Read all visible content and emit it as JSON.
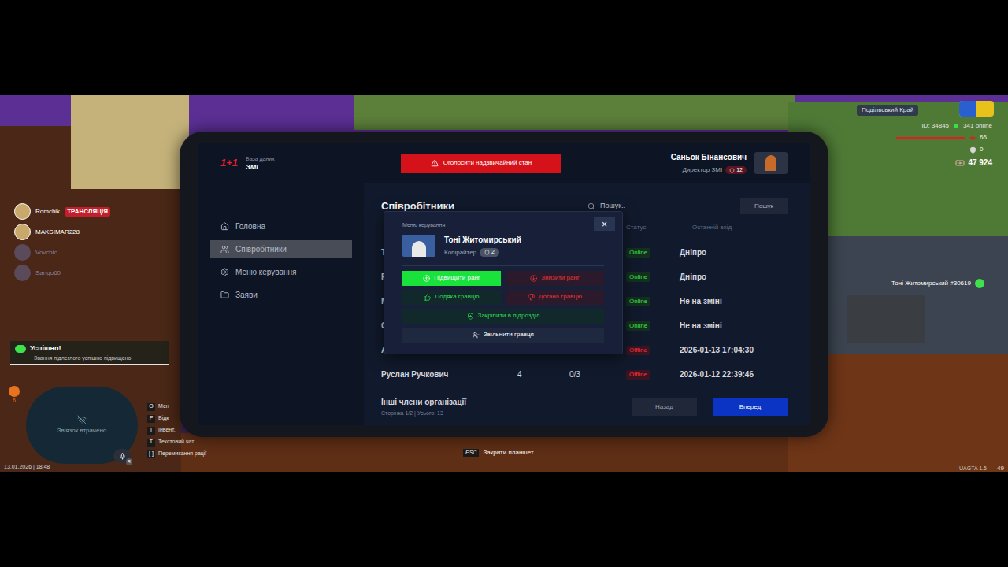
{
  "header": {
    "logo": "1+1",
    "subtitle": "База даних",
    "title": "ЗМІ",
    "emergency_button": "Оголосити надзвичайний стан",
    "user": {
      "name": "Саньок Бінансович",
      "role": "Директор ЗМІ",
      "rank": "12"
    }
  },
  "sidebar": {
    "items": [
      {
        "label": "Головна",
        "selected": false
      },
      {
        "label": "Співробітники",
        "selected": true
      },
      {
        "label": "Меню керування",
        "selected": false
      },
      {
        "label": "Заяви",
        "selected": false
      }
    ]
  },
  "page": {
    "title": "Співробітники",
    "search": {
      "placeholder": "Пошук..",
      "button": "Пошук"
    }
  },
  "table": {
    "columns": [
      {
        "label": "Статус"
      },
      {
        "label": "Останній вхід"
      }
    ],
    "rows": [
      {
        "name": "Т",
        "rank": "",
        "warnings": "",
        "status": "Online",
        "online": true,
        "last": "Дніпро"
      },
      {
        "name": "Р",
        "rank": "",
        "warnings": "",
        "status": "Online",
        "online": true,
        "last": "Дніпро"
      },
      {
        "name": "М",
        "rank": "",
        "warnings": "",
        "status": "Online",
        "online": true,
        "last": "Не на зміні"
      },
      {
        "name": "С",
        "rank": "",
        "warnings": "",
        "status": "Online",
        "online": true,
        "last": "Не на зміні"
      },
      {
        "name": "А",
        "rank": "",
        "warnings": "",
        "status": "Offline",
        "online": false,
        "last": "2026-01-13 17:04:30"
      },
      {
        "name": "Руслан Ручкович",
        "rank": "4",
        "warnings": "0/3",
        "status": "Offline",
        "online": false,
        "last": "2026-01-12 22:39:46"
      }
    ]
  },
  "footer": {
    "title": "Інші члени організації",
    "pagination": "Сторінка 1/2 | Усього: 13",
    "buttons": [
      {
        "label": "Назад",
        "primary": false
      },
      {
        "label": "Вперед",
        "primary": true
      }
    ]
  },
  "modal": {
    "title": "Меню керування",
    "close": "×",
    "player": {
      "name": "Тоні Житомирський",
      "role": "Копірайтер",
      "rank": "2"
    },
    "action_rows": [
      [
        {
          "label": "Підвищити ранг",
          "kind": "positive",
          "hovered": true
        },
        {
          "label": "Знизити ранг",
          "kind": "negative",
          "hovered": false
        }
      ],
      [
        {
          "label": "Подяка гравцю",
          "kind": "positive",
          "hovered": false
        },
        {
          "label": "Догана гравцю",
          "kind": "negative",
          "hovered": false
        }
      ],
      [
        {
          "label": "Закріпити в підрозділ",
          "kind": "positive",
          "hovered": false
        }
      ],
      [
        {
          "label": "Звільнити гравця",
          "kind": "neutral",
          "hovered": false
        }
      ]
    ]
  },
  "hud": {
    "server": "Подільський Край",
    "player_id": "ID: 34845",
    "online": "341 online",
    "health": {
      "value": "66",
      "level": 1
    },
    "armor": "0",
    "money": "47 924",
    "voice": [
      {
        "name": "Romchik",
        "badge": "ТРАНСЛЯЦІЯ",
        "active": true
      },
      {
        "name": "MAKSIMAR228",
        "badge": "",
        "active": true
      },
      {
        "name": "Vovchic",
        "badge": "",
        "active": false
      },
      {
        "name": "Sango60",
        "badge": "",
        "active": false
      }
    ],
    "notification": {
      "title": "Успішно!",
      "text": "Звання підлеглого успішно підвищено"
    },
    "badge_count": "6",
    "minimap": "Зв'язок втрачено",
    "mic_key": "R",
    "keys": [
      {
        "key": "O",
        "label": "Мен"
      },
      {
        "key": "P",
        "label": "Відк"
      },
      {
        "key": "I",
        "label": "Інвент."
      },
      {
        "key": "T",
        "label": "Текстовий чат"
      },
      {
        "key": "[ ]",
        "label": "Перемикання рації"
      }
    ],
    "datetime": "13.01.2026 | 18:48",
    "esc": {
      "key": "ESC",
      "label": "Закрити планшет"
    },
    "version": "UAGTA 1.5",
    "fps": "49",
    "nametag": "Тоні Житомирський #30619"
  }
}
